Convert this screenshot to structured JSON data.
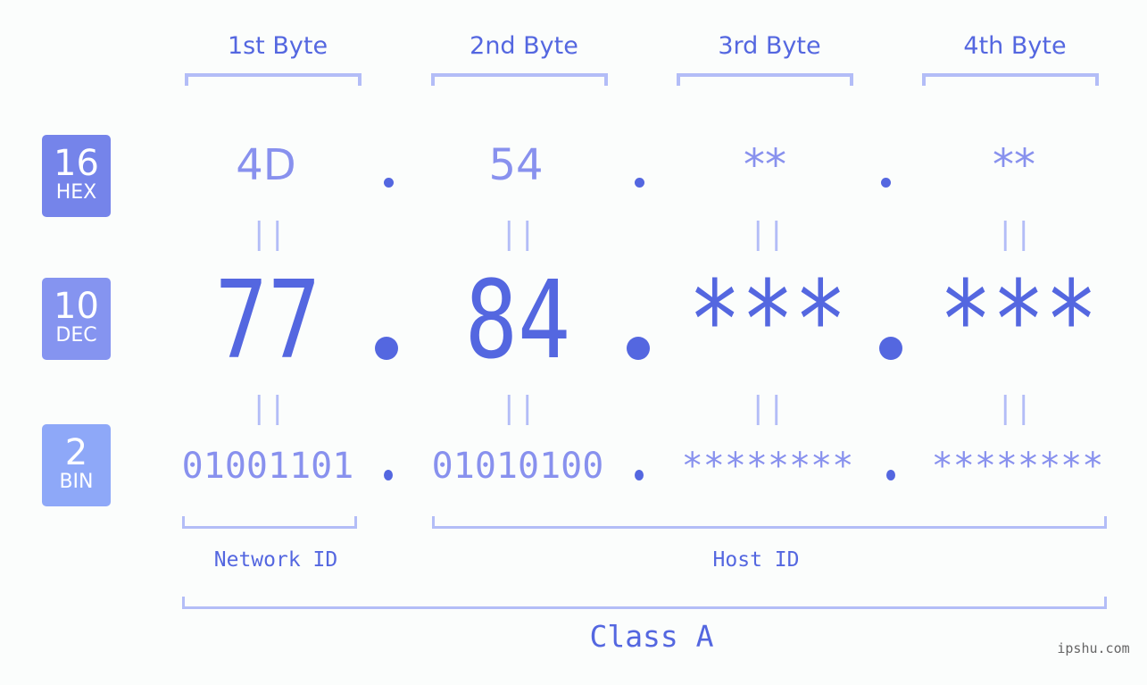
{
  "colors": {
    "hex_badge": "#7584ea",
    "dec_badge": "#8594f0",
    "bin_badge": "#8ea8f8",
    "heading": "#5467e0",
    "value_light": "#8891ee",
    "value_dark": "#5467e0",
    "bracket": "#b3bdf7",
    "dot": "#5467e0",
    "watermark": "#666666"
  },
  "badges": [
    {
      "number": "16",
      "label": "HEX"
    },
    {
      "number": "10",
      "label": "DEC"
    },
    {
      "number": "2",
      "label": "BIN"
    }
  ],
  "byte_headers": [
    "1st Byte",
    "2nd Byte",
    "3rd Byte",
    "4th Byte"
  ],
  "hex_values": [
    "4D",
    "54",
    "**",
    "**"
  ],
  "dec_values": [
    "77",
    "84",
    "***",
    "***"
  ],
  "bin_values": [
    "01001101",
    "01010100",
    "********",
    "********"
  ],
  "equals_symbol": "||",
  "network_label": "Network ID",
  "host_label": "Host ID",
  "class_label": "Class A",
  "watermark": "ipshu.com"
}
